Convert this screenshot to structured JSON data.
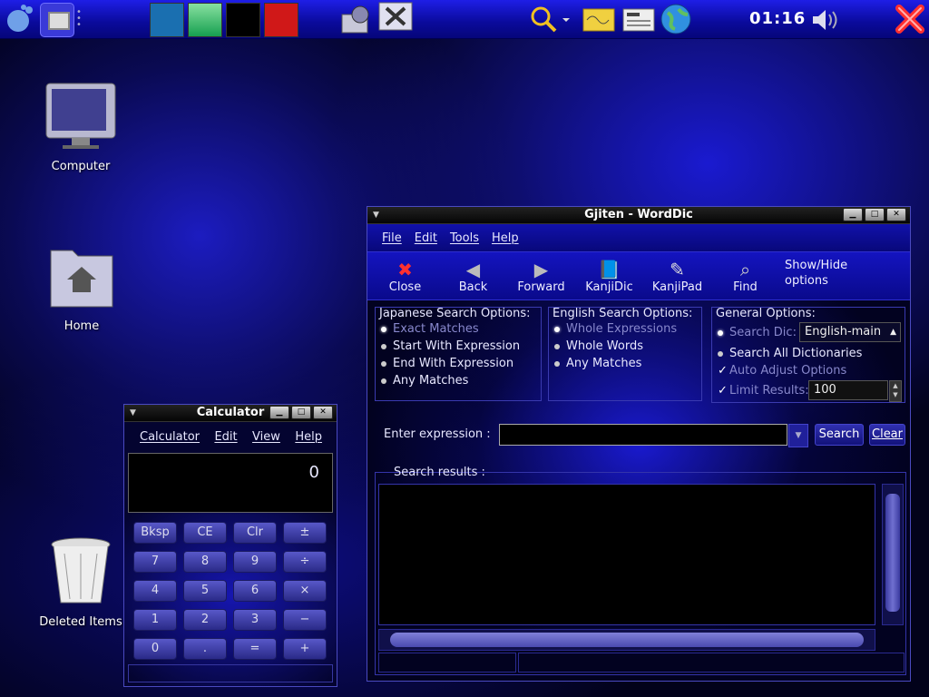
{
  "top_panel": {
    "icons": [
      "gnome-foot-icon",
      "show-desktop-icon",
      "dots-handle-icon",
      "workspace-1",
      "workspace-2",
      "workspace-3",
      "workspace-4",
      "file-manager-icon",
      "preferences-icon",
      "search-icon",
      "sticky-notes-icon",
      "news-icon",
      "globe-icon",
      "volume-icon",
      "logout-icon"
    ],
    "workspace_colors": [
      "#1a6fb0",
      "#22c070",
      "#000000",
      "#d01818"
    ],
    "clock": "01:16"
  },
  "desktop": {
    "computer_label": "Computer",
    "home_label": "Home",
    "trash_label": "Deleted Items"
  },
  "calculator": {
    "title": "Calculator",
    "menu": [
      "Calculator",
      "Edit",
      "View",
      "Help"
    ],
    "display": "0",
    "buttons": [
      [
        "Bksp",
        "CE",
        "Clr",
        "±"
      ],
      [
        "7",
        "8",
        "9",
        "÷"
      ],
      [
        "4",
        "5",
        "6",
        "×"
      ],
      [
        "1",
        "2",
        "3",
        "−"
      ],
      [
        "0",
        ".",
        "=",
        "+"
      ]
    ]
  },
  "gjiten": {
    "title": "Gjiten - WordDic",
    "menu": [
      "File",
      "Edit",
      "Tools",
      "Help"
    ],
    "toolbar": {
      "close": "Close",
      "back": "Back",
      "forward": "Forward",
      "kanjidic": "KanjiDic",
      "kanjipad": "KanjiPad",
      "find": "Find",
      "show_hide": "Show/Hide",
      "options": "options"
    },
    "japanese_options": {
      "title": "Japanese Search Options:",
      "items": [
        "Exact Matches",
        "Start With Expression",
        "End With Expression",
        "Any Matches"
      ]
    },
    "english_options": {
      "title": "English Search Options:",
      "items": [
        "Whole Expressions",
        "Whole Words",
        "Any Matches"
      ]
    },
    "general_options": {
      "title": "General Options:",
      "search_dic": "Search Dic:",
      "dic_value": "English-main",
      "search_all": "Search All Dictionaries",
      "auto_adjust": "Auto Adjust Options",
      "limit_results": "Limit Results:",
      "limit_value": "100"
    },
    "enter_expression": "Enter expression :",
    "expression_value": "",
    "search_button": "Search",
    "clear_button": "Clear",
    "results_label": "Search results :"
  }
}
